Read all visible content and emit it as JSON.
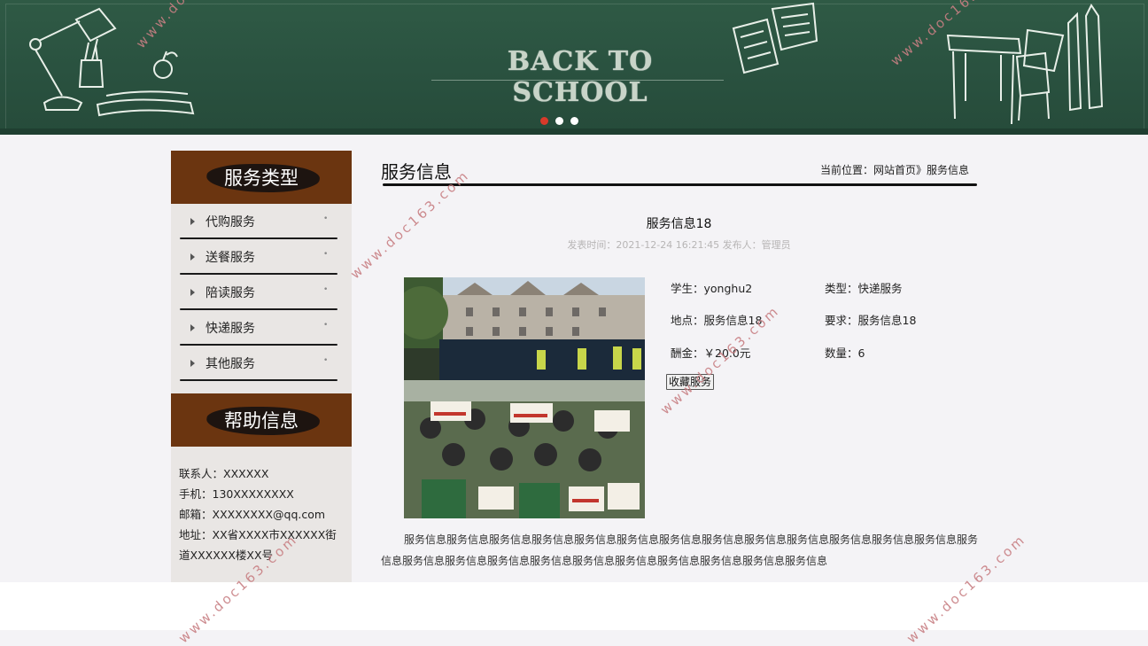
{
  "banner": {
    "title": "BACK TO SCHOOL",
    "slides": 3,
    "active_slide": 1
  },
  "sidebar": {
    "category_heading": "服务类型",
    "categories": [
      "代购服务",
      "送餐服务",
      "陪读服务",
      "快递服务",
      "其他服务"
    ],
    "help_heading": "帮助信息",
    "contact": "联系人：XXXXXX",
    "phone": "手机：130XXXXXXXX",
    "email": "邮箱：XXXXXXXX@qq.com",
    "address": "地址：XX省XXXX市XXXXXX街道XXXXXX楼XX号"
  },
  "main": {
    "section_title": "服务信息",
    "breadcrumb": "当前位置：网站首页》服务信息",
    "post_title": "服务信息18",
    "post_meta": "发表时间：2021-12-24 16:21:45 发布人：管理员",
    "fields": {
      "student": "学生：yonghu2",
      "type": "类型：快递服务",
      "location": "地点：服务信息18",
      "requirement": "要求：服务信息18",
      "reward": "酬金：￥20.0元",
      "quantity": "数量：6"
    },
    "action_button": "收藏服务",
    "description": "服务信息服务信息服务信息服务信息服务信息服务信息服务信息服务信息服务信息服务信息服务信息服务信息服务信息服务信息服务信息服务信息服务信息服务信息服务信息服务信息服务信息服务信息服务信息服务信息"
  },
  "watermark": "www.doc163.com",
  "colors": {
    "banner": "#2a5240",
    "sidebar_header": "#6b3510",
    "active_dot": "#d83a2a"
  }
}
